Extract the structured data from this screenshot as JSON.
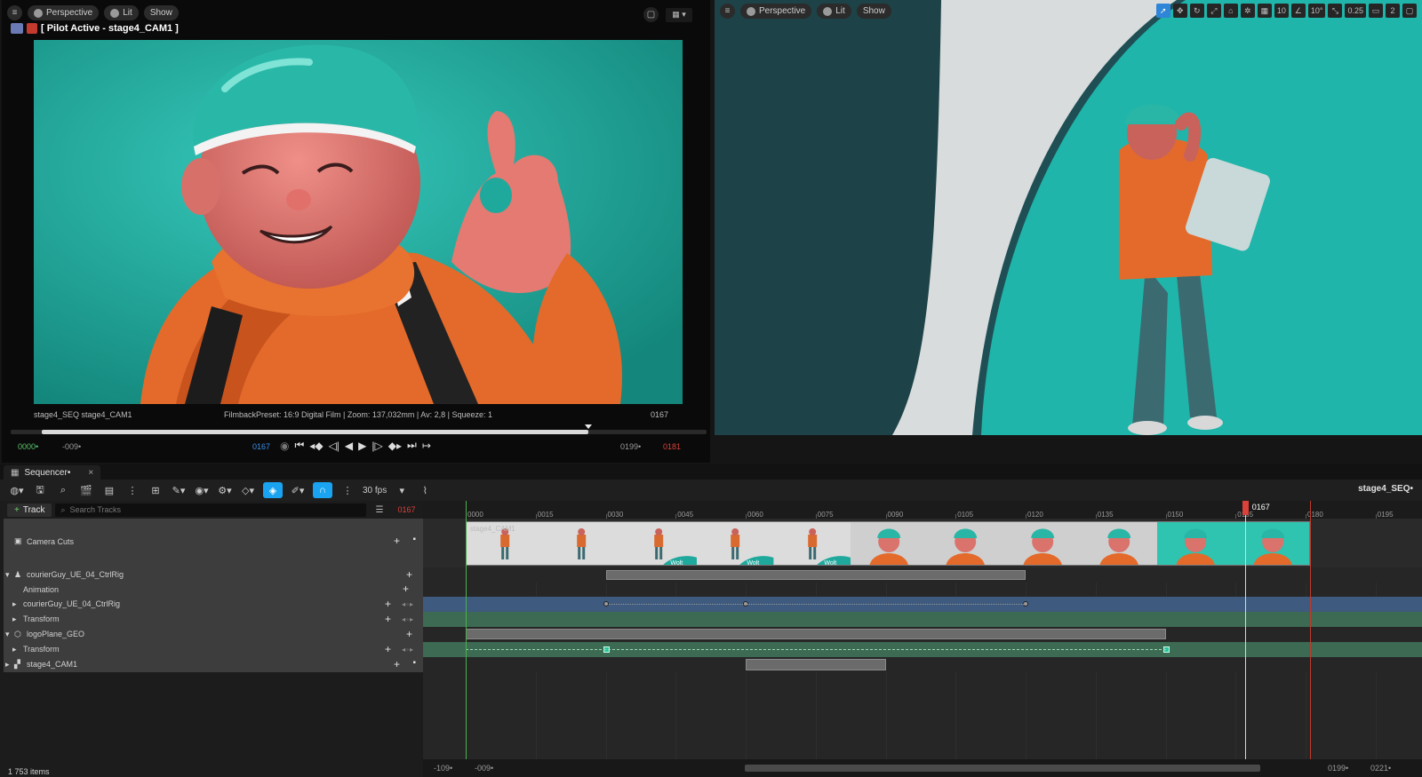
{
  "left_viewport": {
    "menu_icon": "hamburger-icon",
    "perspective_label": "Perspective",
    "lit_label": "Lit",
    "show_label": "Show",
    "pilot_label": "[ Pilot Active - stage4_CAM1 ]",
    "camera_info_left": "stage4_SEQ  stage4_CAM1",
    "camera_info_center": "FilmbackPreset: 16:9 Digital Film | Zoom: 137,032mm | Av: 2,8 | Squeeze: 1",
    "camera_info_frame": "0167",
    "scrub_progress": 0.83,
    "tc_start": "0000•",
    "tc_start_color": "#5bc26a",
    "tc_offset": "-009•",
    "tc_current": "0167",
    "tc_current_color": "#3a8ee6",
    "tc_end": "0199•",
    "tc_end2": "0181",
    "tc_end2_color": "#d9413a"
  },
  "right_viewport": {
    "perspective_label": "Perspective",
    "lit_label": "Lit",
    "show_label": "Show",
    "grid_value": "10",
    "angle_value": "10°",
    "scale_value": "0.25",
    "camera_speed": "2"
  },
  "sequencer": {
    "tab_label": "Sequencer•",
    "fps_label": "30 fps",
    "sequence_name": "stage4_SEQ•",
    "track_button": "Track",
    "search_placeholder": "Search Tracks",
    "current_frame": "0167",
    "items_count": "1 753 items",
    "tracks": [
      {
        "label": "Camera Cuts",
        "icon": "camera-cuts-icon"
      },
      {
        "label": "courierGuy_UE_04_CtrlRig",
        "icon": "skeletal-mesh-icon"
      },
      {
        "label": "Animation"
      },
      {
        "label": "courierGuy_UE_04_CtrlRig"
      },
      {
        "label": "Transform"
      },
      {
        "label": "logoPlane_GEO",
        "icon": "static-mesh-icon"
      },
      {
        "label": "Transform"
      },
      {
        "label": "stage4_CAM1",
        "icon": "camera-actor-icon"
      }
    ],
    "ruler_labels": [
      "0000",
      "0015",
      "0030",
      "0045",
      "0060",
      "0075",
      "0090",
      "0105",
      "0120",
      "0135",
      "0150",
      "0165",
      "0180",
      "0195"
    ],
    "playhead_label": "0167",
    "playhead_color": "#d9413a",
    "range_start_left": "-109•",
    "range_start_right": "-009•",
    "range_end_left": "0199•",
    "range_end_right": "0221•",
    "camera_cut_label": "stage4_CAM1",
    "thumb_logo_text": "Wolt"
  }
}
